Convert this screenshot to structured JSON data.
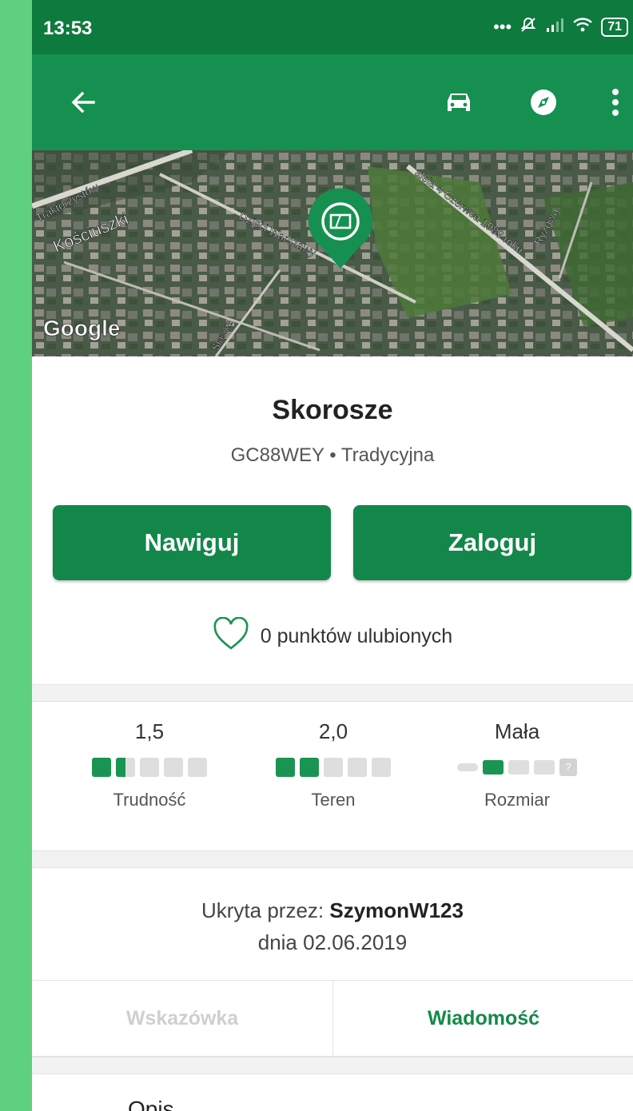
{
  "status_bar": {
    "time": "13:53",
    "battery": "71"
  },
  "app_bar": {
    "icons": [
      "back-arrow-icon",
      "car-icon",
      "compass-icon",
      "more-vert-icon"
    ],
    "color": "#169050"
  },
  "map": {
    "watermark": "Google",
    "street_labels": [
      "Traktorzystów",
      "Kościuszki",
      "Dzieci Warszawy",
      "aleja 4 Czerwca 1989 roku",
      "Ryżowa",
      "Sławka"
    ]
  },
  "cache": {
    "name": "Skorosze",
    "code_type": "GC88WEY • Tradycyjna"
  },
  "actions": {
    "navigate_label": "Nawiguj",
    "log_label": "Zaloguj"
  },
  "favorites": {
    "text": "0 punktów ulubionych"
  },
  "stats": {
    "difficulty": {
      "value": "1,5",
      "label": "Trudność",
      "rating": 1.5,
      "max": 5
    },
    "terrain": {
      "value": "2,0",
      "label": "Teren",
      "rating": 2.0,
      "max": 5
    },
    "size": {
      "value": "Mała",
      "label": "Rozmiar",
      "level": 2,
      "unknown_glyph": "?"
    }
  },
  "owner": {
    "prefix": "Ukryta przez: ",
    "name": "SzymonW123",
    "date": "dnia 02.06.2019"
  },
  "tabs": {
    "hint_label": "Wskazówka",
    "message_label": "Wiadomość"
  },
  "section": {
    "description_label": "Opis"
  },
  "colors": {
    "primary": "#13874a",
    "status_bar": "#0d7a3e",
    "background": "#5fcf80"
  }
}
